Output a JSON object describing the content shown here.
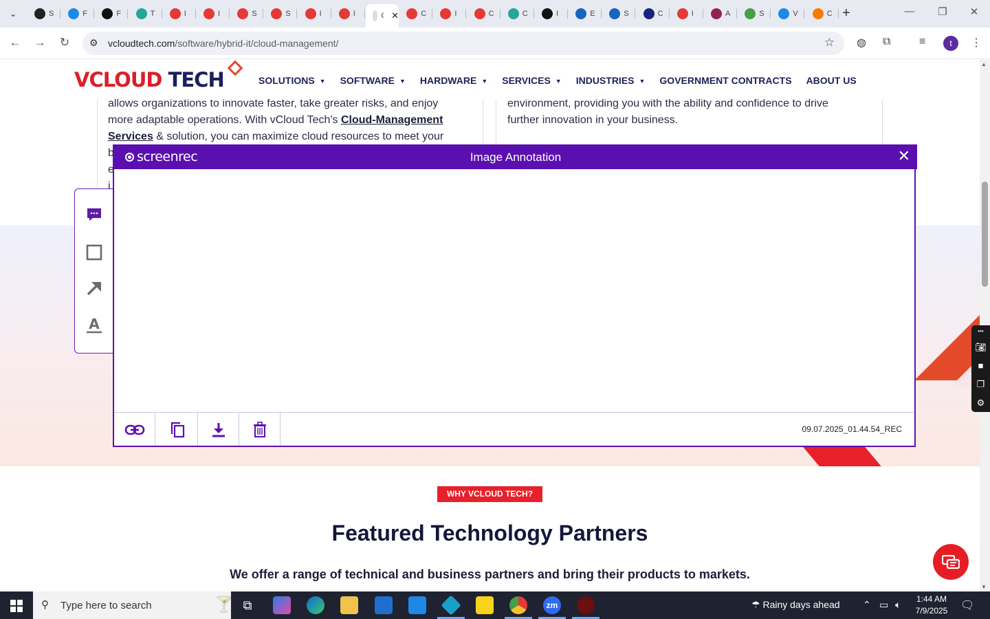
{
  "browser": {
    "tabs": [
      {
        "title": "S",
        "color": "#222222"
      },
      {
        "title": "F",
        "color": "#1e88e5"
      },
      {
        "title": "F",
        "color": "#111111"
      },
      {
        "title": "T",
        "color": "#26a69a"
      },
      {
        "title": "I",
        "color": "#e53935"
      },
      {
        "title": "I",
        "color": "#e53935"
      },
      {
        "title": "S",
        "color": "#e53935"
      },
      {
        "title": "S",
        "color": "#e53935"
      },
      {
        "title": "I",
        "color": "#e53935"
      },
      {
        "title": "I",
        "color": "#e53935"
      },
      {
        "title": "C",
        "color": "#dddddd",
        "active": true
      },
      {
        "title": "C",
        "color": "#e53935"
      },
      {
        "title": "I",
        "color": "#e53935"
      },
      {
        "title": "C",
        "color": "#e53935"
      },
      {
        "title": "C",
        "color": "#26a69a"
      },
      {
        "title": "I",
        "color": "#111111"
      },
      {
        "title": "E",
        "color": "#1565c0"
      },
      {
        "title": "S",
        "color": "#1565c0"
      },
      {
        "title": "C",
        "color": "#1a237e"
      },
      {
        "title": "I",
        "color": "#e53935"
      },
      {
        "title": "A",
        "color": "#8e244d"
      },
      {
        "title": "S",
        "color": "#43a047"
      },
      {
        "title": "V",
        "color": "#1e88e5"
      },
      {
        "title": "C",
        "color": "#f57c00"
      }
    ],
    "url_domain": "vcloudtech.com",
    "url_path": "/software/hybrid-it/cloud-management/",
    "profile_initial": "t"
  },
  "site": {
    "logo_v": "V",
    "logo_cloud": "CLOUD",
    "logo_tech": " TECH",
    "nav": [
      {
        "label": "SOLUTIONS",
        "dropdown": true
      },
      {
        "label": "SOFTWARE",
        "dropdown": true
      },
      {
        "label": "HARDWARE",
        "dropdown": true
      },
      {
        "label": "SERVICES",
        "dropdown": true
      },
      {
        "label": "INDUSTRIES",
        "dropdown": true
      },
      {
        "label": "GOVERNMENT CONTRACTS",
        "dropdown": false
      },
      {
        "label": "ABOUT US",
        "dropdown": false
      }
    ],
    "left_col": {
      "line1": "allows organizations to innovate faster, take greater risks, and enjoy",
      "line2_pre": "more adaptable operations. With vCloud Tech's ",
      "link1": "Cloud-Management",
      "link2": "Services",
      "line3_post": " & solution, you can maximize cloud resources to meet your",
      "cut_letters": [
        "b",
        "e",
        "i"
      ]
    },
    "right_col": {
      "line1": "environment, providing you with the ability and confidence to drive",
      "line2": "further innovation in your business."
    },
    "why_badge": "WHY VCLOUD TECH?",
    "featured_title": "Featured Technology Partners",
    "featured_sub": "We offer a range of technical and business partners and bring their products to markets."
  },
  "annotation": {
    "app_name": "screenrec",
    "title": "Image Annotation",
    "filename": "09.07.2025_01.44.54_REC",
    "tools": [
      {
        "name": "comment-tool",
        "icon": "speech-bubble-icon"
      },
      {
        "name": "rectangle-tool",
        "icon": "rectangle-icon"
      },
      {
        "name": "arrow-tool",
        "icon": "arrow-icon"
      },
      {
        "name": "text-tool",
        "icon": "text-icon"
      }
    ],
    "footer_actions": [
      "copy-link",
      "copy",
      "download",
      "delete"
    ],
    "accent_color": "#5a10b0"
  },
  "taskbar": {
    "search_placeholder": "Type here to search",
    "weather": "Rainy days ahead",
    "time": "1:44 AM",
    "date": "7/9/2025"
  }
}
